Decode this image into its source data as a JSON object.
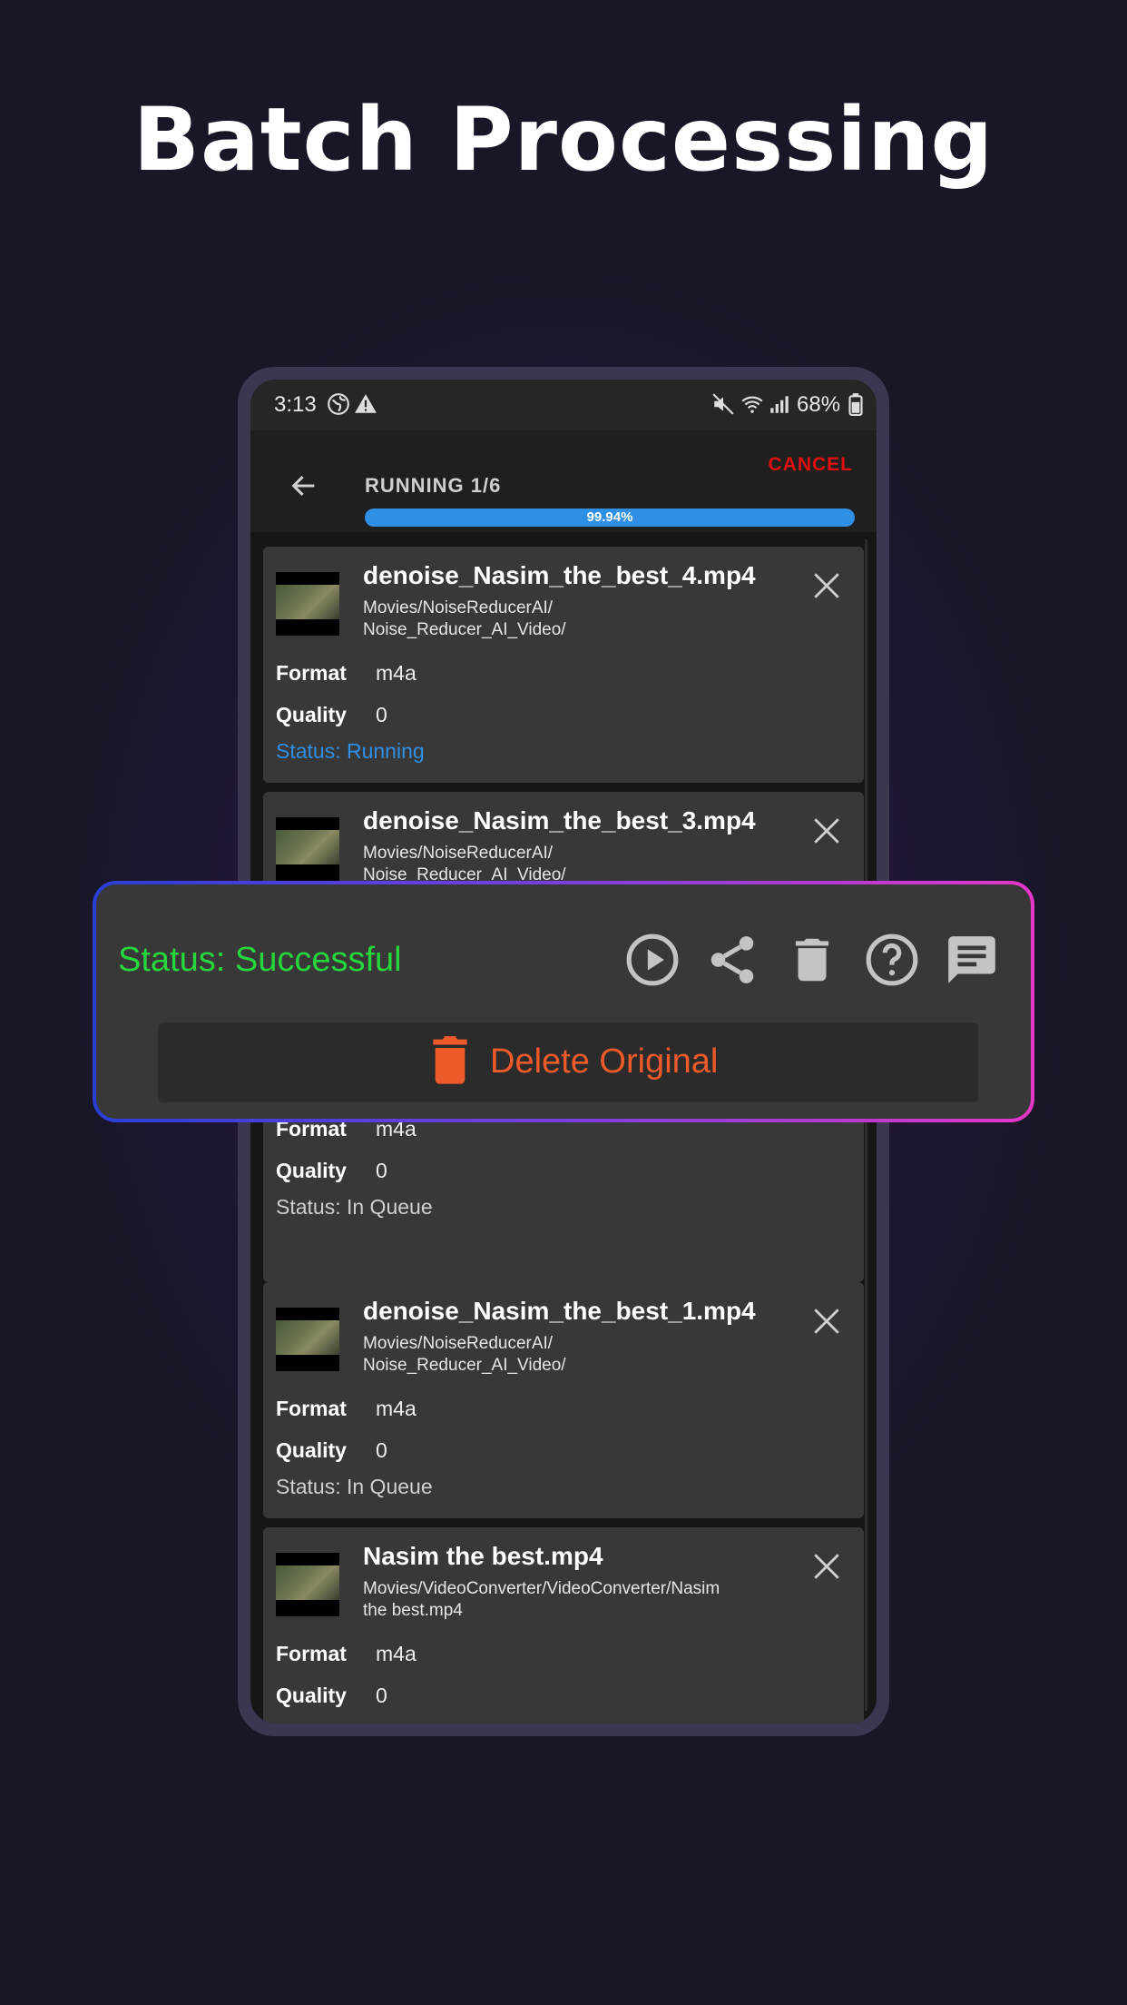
{
  "headline": "Batch Processing",
  "statusbar": {
    "time": "3:13",
    "battery": "68%"
  },
  "appbar": {
    "title": "RUNNING 1/6",
    "cancel_label": "CANCEL",
    "progress_text": "99.94%",
    "progress_value": 99.94
  },
  "files": [
    {
      "name": "denoise_Nasim_the_best_4.mp4",
      "path": "Movies/NoiseReducerAI/\nNoise_Reducer_AI_Video/",
      "format_label": "Format",
      "format": "m4a",
      "quality_label": "Quality",
      "quality": "0",
      "status": "Status: Running"
    },
    {
      "name": "denoise_Nasim_the_best_3.mp4",
      "path": "Movies/NoiseReducerAI/\nNoise_Reducer_AI_Video/"
    },
    {
      "format_label": "Format",
      "format": "m4a",
      "quality_label": "Quality",
      "quality": "0",
      "status": "Status: In Queue"
    },
    {
      "name": "denoise_Nasim_the_best_1.mp4",
      "path": "Movies/NoiseReducerAI/\nNoise_Reducer_AI_Video/",
      "format_label": "Format",
      "format": "m4a",
      "quality_label": "Quality",
      "quality": "0",
      "status": "Status: In Queue"
    },
    {
      "name": "Nasim the best.mp4",
      "path": "Movies/VideoConverter/VideoConverter/Nasim\nthe best.mp4",
      "format_label": "Format",
      "format": "m4a",
      "quality_label": "Quality",
      "quality": "0"
    }
  ],
  "overlay": {
    "status": "Status: Successful",
    "icons": [
      "play-icon",
      "share-icon",
      "trash-icon",
      "help-icon",
      "message-icon"
    ],
    "delete_label": "Delete Original"
  },
  "colors": {
    "running": "#2f8fe5",
    "success": "#26d63c",
    "cancel": "#e01010",
    "delete": "#ee5a2a"
  }
}
